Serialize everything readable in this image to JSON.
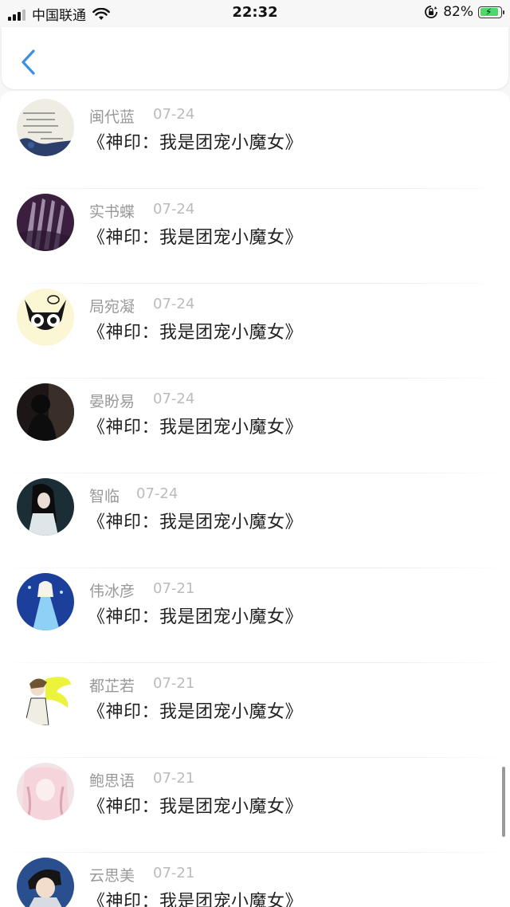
{
  "status_bar": {
    "carrier": "中国联通",
    "time": "22:32",
    "battery_percent": "82%"
  },
  "nav": {
    "back_icon": "chevron-left-icon",
    "accent_color": "#3d8fe0"
  },
  "items": [
    {
      "name": "闽代蓝",
      "date": "07-24",
      "title": "《神印：我是团宠小魔女》",
      "avatar": "handwriting-photo"
    },
    {
      "name": "实书蝶",
      "date": "07-24",
      "title": "《神印：我是团宠小魔女》",
      "avatar": "hands-photo"
    },
    {
      "name": "局宛凝",
      "date": "07-24",
      "title": "《神印：我是团宠小魔女》",
      "avatar": "cartoon-cat"
    },
    {
      "name": "晏盼易",
      "date": "07-24",
      "title": "《神印：我是团宠小魔女》",
      "avatar": "dark-figure"
    },
    {
      "name": "智临",
      "date": "07-24",
      "title": "《神印：我是团宠小魔女》",
      "avatar": "girl-long-hair"
    },
    {
      "name": "伟冰彦",
      "date": "07-21",
      "title": "《神印：我是团宠小魔女》",
      "avatar": "ice-princess"
    },
    {
      "name": "都芷若",
      "date": "07-21",
      "title": "《神印：我是团宠小魔女》",
      "avatar": "anime-boy"
    },
    {
      "name": "鲍思语",
      "date": "07-21",
      "title": "《神印：我是团宠小魔女》",
      "avatar": "pink-anime-girl"
    },
    {
      "name": "云思美",
      "date": "07-21",
      "title": "《神印：我是团宠小魔女》",
      "avatar": "anime-character"
    }
  ]
}
